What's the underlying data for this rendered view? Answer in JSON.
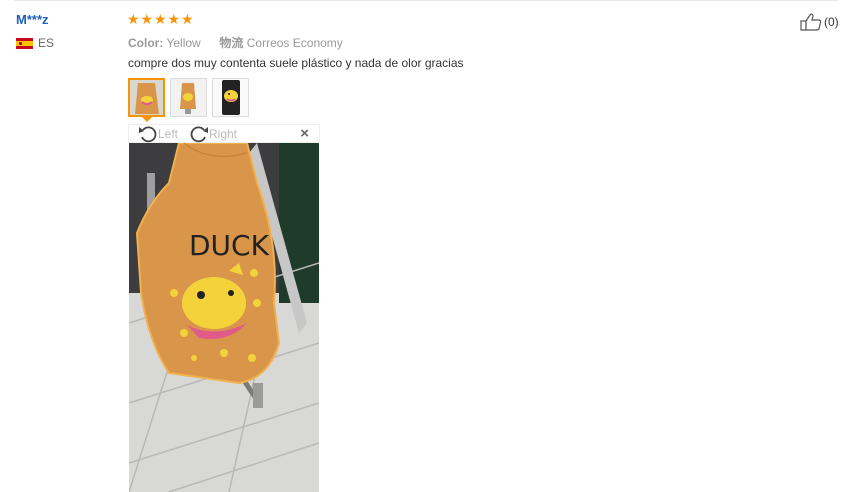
{
  "review": {
    "user_name": "M***z",
    "country_code": "ES",
    "rating": 5,
    "color_label": "Color:",
    "color_value": "Yellow",
    "logistics_label": "物流",
    "logistics_value": "Correos Economy",
    "text": "compre dos muy contenta suele plástico y nada de olor gracias",
    "like_count": "(0)"
  },
  "viewer": {
    "rotate_left_label": "Left",
    "rotate_right_label": "Right",
    "close_symbol": "×"
  },
  "icons": {
    "flag": "spain-flag-icon",
    "stars": "star-icon",
    "like": "thumbs-up-icon",
    "rotate_left": "rotate-left-icon",
    "rotate_right": "rotate-right-icon"
  },
  "colors": {
    "username": "#1e5fbf",
    "star": "#f89406",
    "active_thumb_border": "#f89406"
  }
}
